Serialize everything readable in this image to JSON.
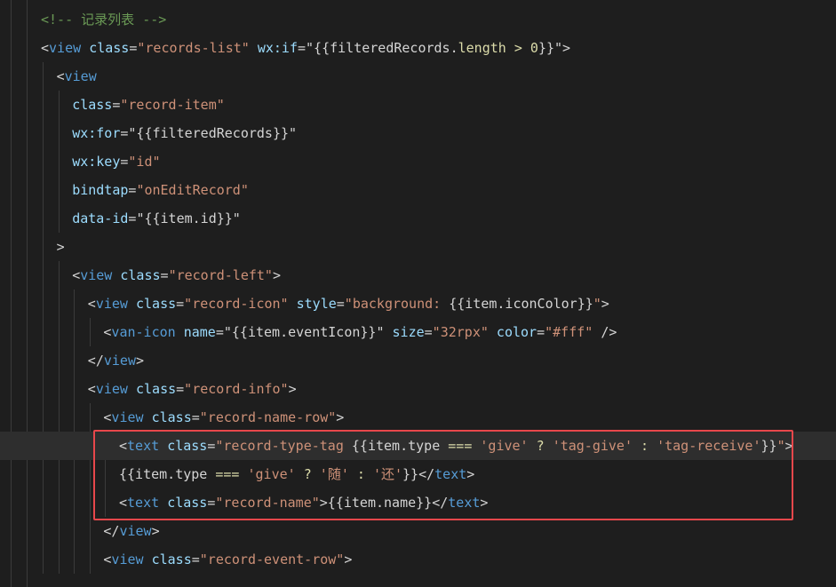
{
  "editor": {
    "accent": "#e8474b",
    "highlighted_lines": [
      16,
      17,
      18
    ],
    "lines": [
      {
        "indent": 0,
        "tokens": [
          {
            "t": "com",
            "v": "<!-- "
          },
          {
            "t": "comcjk",
            "v": "记录列表"
          },
          {
            "t": "com",
            "v": " -->"
          }
        ]
      },
      {
        "indent": 0,
        "tokens": [
          {
            "t": "punc",
            "v": "<"
          },
          {
            "t": "tag",
            "v": "view"
          },
          {
            "t": "punc",
            "v": " "
          },
          {
            "t": "attr",
            "v": "class"
          },
          {
            "t": "punc",
            "v": "="
          },
          {
            "t": "str",
            "v": "\"records-list\""
          },
          {
            "t": "punc",
            "v": " "
          },
          {
            "t": "attr",
            "v": "wx:if"
          },
          {
            "t": "punc",
            "v": "="
          },
          {
            "t": "punc",
            "v": "\"{{filteredRecords."
          },
          {
            "t": "yel",
            "v": "length"
          },
          {
            "t": "punc",
            "v": " "
          },
          {
            "t": "yel",
            "v": ">"
          },
          {
            "t": "punc",
            "v": " "
          },
          {
            "t": "yel",
            "v": "0"
          },
          {
            "t": "punc",
            "v": "}}\""
          },
          {
            "t": "punc",
            "v": ">"
          }
        ]
      },
      {
        "indent": 1,
        "tokens": [
          {
            "t": "punc",
            "v": "<"
          },
          {
            "t": "tag",
            "v": "view"
          }
        ]
      },
      {
        "indent": 2,
        "tokens": [
          {
            "t": "attr",
            "v": "class"
          },
          {
            "t": "punc",
            "v": "="
          },
          {
            "t": "str",
            "v": "\"record-item\""
          }
        ]
      },
      {
        "indent": 2,
        "tokens": [
          {
            "t": "attr",
            "v": "wx:for"
          },
          {
            "t": "punc",
            "v": "="
          },
          {
            "t": "punc",
            "v": "\"{{filteredRecords}}\""
          }
        ]
      },
      {
        "indent": 2,
        "tokens": [
          {
            "t": "attr",
            "v": "wx:key"
          },
          {
            "t": "punc",
            "v": "="
          },
          {
            "t": "str",
            "v": "\"id\""
          }
        ]
      },
      {
        "indent": 2,
        "tokens": [
          {
            "t": "attr",
            "v": "bindtap"
          },
          {
            "t": "punc",
            "v": "="
          },
          {
            "t": "str",
            "v": "\"onEditRecord\""
          }
        ]
      },
      {
        "indent": 2,
        "tokens": [
          {
            "t": "attr",
            "v": "data-id"
          },
          {
            "t": "punc",
            "v": "="
          },
          {
            "t": "punc",
            "v": "\"{{item.id}}\""
          }
        ]
      },
      {
        "indent": 1,
        "tokens": [
          {
            "t": "punc",
            "v": ">"
          }
        ]
      },
      {
        "indent": 2,
        "tokens": [
          {
            "t": "punc",
            "v": "<"
          },
          {
            "t": "tag",
            "v": "view"
          },
          {
            "t": "punc",
            "v": " "
          },
          {
            "t": "attr",
            "v": "class"
          },
          {
            "t": "punc",
            "v": "="
          },
          {
            "t": "str",
            "v": "\"record-left\""
          },
          {
            "t": "punc",
            "v": ">"
          }
        ]
      },
      {
        "indent": 3,
        "tokens": [
          {
            "t": "punc",
            "v": "<"
          },
          {
            "t": "tag",
            "v": "view"
          },
          {
            "t": "punc",
            "v": " "
          },
          {
            "t": "attr",
            "v": "class"
          },
          {
            "t": "punc",
            "v": "="
          },
          {
            "t": "str",
            "v": "\"record-icon\""
          },
          {
            "t": "punc",
            "v": " "
          },
          {
            "t": "attr",
            "v": "style"
          },
          {
            "t": "punc",
            "v": "="
          },
          {
            "t": "str",
            "v": "\"background: "
          },
          {
            "t": "punc",
            "v": "{{item.iconColor}}"
          },
          {
            "t": "str",
            "v": "\""
          },
          {
            "t": "punc",
            "v": ">"
          }
        ]
      },
      {
        "indent": 4,
        "tokens": [
          {
            "t": "punc",
            "v": "<"
          },
          {
            "t": "tag",
            "v": "van-icon"
          },
          {
            "t": "punc",
            "v": " "
          },
          {
            "t": "attr",
            "v": "name"
          },
          {
            "t": "punc",
            "v": "="
          },
          {
            "t": "punc",
            "v": "\"{{item.eventIcon}}\""
          },
          {
            "t": "punc",
            "v": " "
          },
          {
            "t": "attr",
            "v": "size"
          },
          {
            "t": "punc",
            "v": "="
          },
          {
            "t": "str",
            "v": "\"32rpx\""
          },
          {
            "t": "punc",
            "v": " "
          },
          {
            "t": "attr",
            "v": "color"
          },
          {
            "t": "punc",
            "v": "="
          },
          {
            "t": "str",
            "v": "\"#fff\""
          },
          {
            "t": "punc",
            "v": " />"
          }
        ]
      },
      {
        "indent": 3,
        "tokens": [
          {
            "t": "punc",
            "v": "</"
          },
          {
            "t": "tag",
            "v": "view"
          },
          {
            "t": "punc",
            "v": ">"
          }
        ]
      },
      {
        "indent": 3,
        "tokens": [
          {
            "t": "punc",
            "v": "<"
          },
          {
            "t": "tag",
            "v": "view"
          },
          {
            "t": "punc",
            "v": " "
          },
          {
            "t": "attr",
            "v": "class"
          },
          {
            "t": "punc",
            "v": "="
          },
          {
            "t": "str",
            "v": "\"record-info\""
          },
          {
            "t": "punc",
            "v": ">"
          }
        ]
      },
      {
        "indent": 4,
        "tokens": [
          {
            "t": "punc",
            "v": "<"
          },
          {
            "t": "tag",
            "v": "view"
          },
          {
            "t": "punc",
            "v": " "
          },
          {
            "t": "attr",
            "v": "class"
          },
          {
            "t": "punc",
            "v": "="
          },
          {
            "t": "str",
            "v": "\"record-name-row\""
          },
          {
            "t": "punc",
            "v": ">"
          }
        ]
      },
      {
        "indent": 5,
        "current": true,
        "tokens": [
          {
            "t": "punc",
            "v": "<"
          },
          {
            "t": "tag",
            "v": "text"
          },
          {
            "t": "punc",
            "v": " "
          },
          {
            "t": "attr",
            "v": "class"
          },
          {
            "t": "punc",
            "v": "="
          },
          {
            "t": "str",
            "v": "\"record-type-tag "
          },
          {
            "t": "punc",
            "v": "{{item.type "
          },
          {
            "t": "yel",
            "v": "==="
          },
          {
            "t": "punc",
            "v": " "
          },
          {
            "t": "str",
            "v": "'give'"
          },
          {
            "t": "punc",
            "v": " "
          },
          {
            "t": "yel",
            "v": "?"
          },
          {
            "t": "punc",
            "v": " "
          },
          {
            "t": "str",
            "v": "'tag-give'"
          },
          {
            "t": "punc",
            "v": " "
          },
          {
            "t": "yel",
            "v": ":"
          },
          {
            "t": "punc",
            "v": " "
          },
          {
            "t": "str",
            "v": "'tag-receive'"
          },
          {
            "t": "punc",
            "v": "}}"
          },
          {
            "t": "str",
            "v": "\""
          },
          {
            "t": "punc",
            "v": ">"
          }
        ]
      },
      {
        "indent": 5,
        "tokens": [
          {
            "t": "punc",
            "v": "{{item.type "
          },
          {
            "t": "yel",
            "v": "==="
          },
          {
            "t": "punc",
            "v": " "
          },
          {
            "t": "str",
            "v": "'give'"
          },
          {
            "t": "punc",
            "v": " "
          },
          {
            "t": "yel",
            "v": "?"
          },
          {
            "t": "punc",
            "v": " "
          },
          {
            "t": "str",
            "v": "'"
          },
          {
            "t": "cjk",
            "v": "随"
          },
          {
            "t": "str",
            "v": "'"
          },
          {
            "t": "punc",
            "v": " "
          },
          {
            "t": "yel",
            "v": ":"
          },
          {
            "t": "punc",
            "v": " "
          },
          {
            "t": "str",
            "v": "'"
          },
          {
            "t": "cjk",
            "v": "还"
          },
          {
            "t": "str",
            "v": "'"
          },
          {
            "t": "punc",
            "v": "}}</"
          },
          {
            "t": "tag",
            "v": "text"
          },
          {
            "t": "punc",
            "v": ">"
          }
        ]
      },
      {
        "indent": 5,
        "tokens": [
          {
            "t": "punc",
            "v": "<"
          },
          {
            "t": "tag",
            "v": "text"
          },
          {
            "t": "punc",
            "v": " "
          },
          {
            "t": "attr",
            "v": "class"
          },
          {
            "t": "punc",
            "v": "="
          },
          {
            "t": "str",
            "v": "\"record-name\""
          },
          {
            "t": "punc",
            "v": ">{{item.name}}</"
          },
          {
            "t": "tag",
            "v": "text"
          },
          {
            "t": "punc",
            "v": ">"
          }
        ]
      },
      {
        "indent": 4,
        "tokens": [
          {
            "t": "punc",
            "v": "</"
          },
          {
            "t": "tag",
            "v": "view"
          },
          {
            "t": "punc",
            "v": ">"
          }
        ]
      },
      {
        "indent": 4,
        "tokens": [
          {
            "t": "punc",
            "v": "<"
          },
          {
            "t": "tag",
            "v": "view"
          },
          {
            "t": "punc",
            "v": " "
          },
          {
            "t": "attr",
            "v": "class"
          },
          {
            "t": "punc",
            "v": "="
          },
          {
            "t": "str",
            "v": "\"record-event-row\""
          },
          {
            "t": "punc",
            "v": ">"
          }
        ]
      }
    ]
  }
}
